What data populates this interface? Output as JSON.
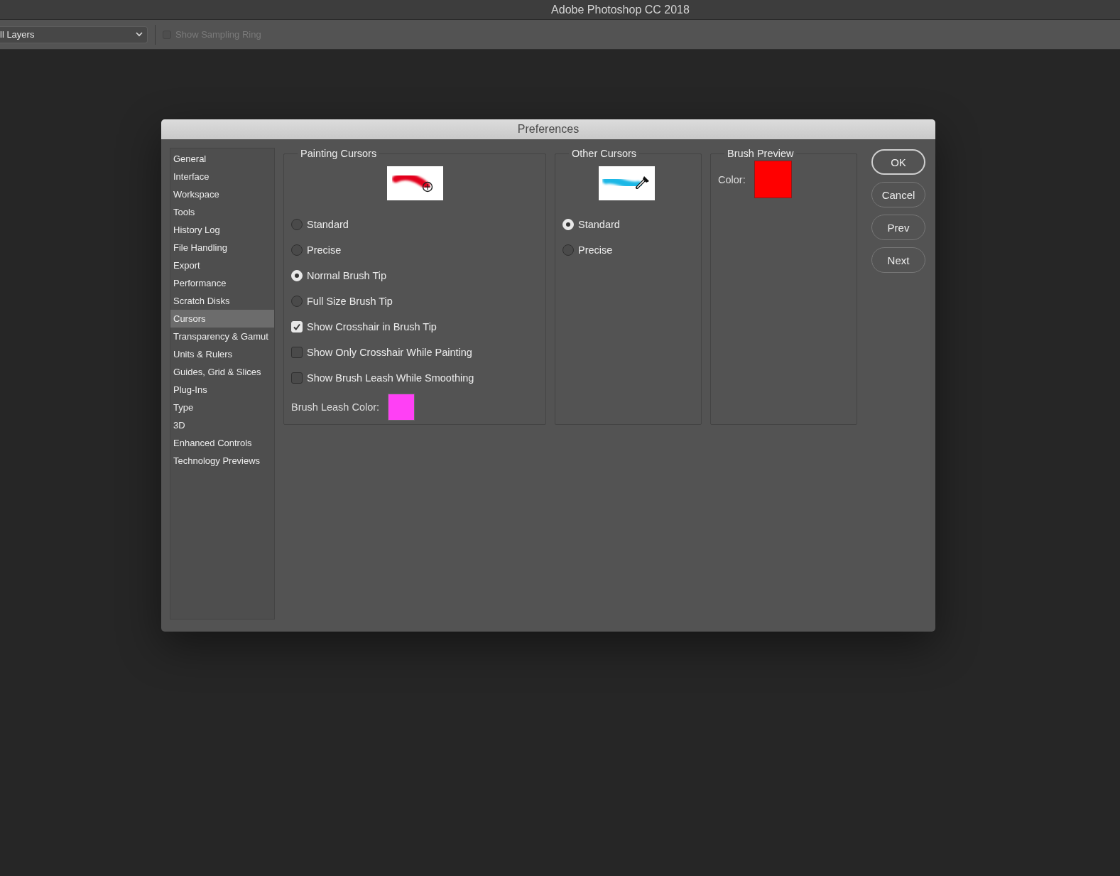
{
  "app_title": "Adobe Photoshop CC 2018",
  "toolbar": {
    "sample_dropdown": {
      "value": "ll Layers"
    },
    "sampling_ring": {
      "label": "Show Sampling Ring",
      "checked": false,
      "disabled": true
    }
  },
  "dialog": {
    "title": "Preferences",
    "sidebar": {
      "items": [
        {
          "label": "General",
          "selected": false
        },
        {
          "label": "Interface",
          "selected": false
        },
        {
          "label": "Workspace",
          "selected": false
        },
        {
          "label": "Tools",
          "selected": false
        },
        {
          "label": "History Log",
          "selected": false
        },
        {
          "label": "File Handling",
          "selected": false
        },
        {
          "label": "Export",
          "selected": false
        },
        {
          "label": "Performance",
          "selected": false
        },
        {
          "label": "Scratch Disks",
          "selected": false
        },
        {
          "label": "Cursors",
          "selected": true
        },
        {
          "label": "Transparency & Gamut",
          "selected": false
        },
        {
          "label": "Units & Rulers",
          "selected": false
        },
        {
          "label": "Guides, Grid & Slices",
          "selected": false
        },
        {
          "label": "Plug-Ins",
          "selected": false
        },
        {
          "label": "Type",
          "selected": false
        },
        {
          "label": "3D",
          "selected": false
        },
        {
          "label": "Enhanced Controls",
          "selected": false
        },
        {
          "label": "Technology Previews",
          "selected": false
        }
      ]
    },
    "painting_cursors": {
      "title": "Painting Cursors",
      "options": [
        {
          "kind": "radio",
          "label": "Standard",
          "selected": false
        },
        {
          "kind": "radio",
          "label": "Precise",
          "selected": false
        },
        {
          "kind": "radio",
          "label": "Normal Brush Tip",
          "selected": true
        },
        {
          "kind": "radio",
          "label": "Full Size Brush Tip",
          "selected": false
        },
        {
          "kind": "checkbox",
          "label": "Show Crosshair in Brush Tip",
          "checked": true
        },
        {
          "kind": "checkbox",
          "label": "Show Only Crosshair While Painting",
          "checked": false
        },
        {
          "kind": "checkbox",
          "label": "Show Brush Leash While Smoothing",
          "checked": false
        }
      ],
      "leash": {
        "label": "Brush Leash Color:",
        "color": "#ff40f5"
      }
    },
    "other_cursors": {
      "title": "Other Cursors",
      "options": [
        {
          "kind": "radio",
          "label": "Standard",
          "selected": true
        },
        {
          "kind": "radio",
          "label": "Precise",
          "selected": false
        }
      ]
    },
    "brush_preview": {
      "title": "Brush Preview",
      "label": "Color:",
      "color": "#ff0000"
    },
    "buttons": [
      {
        "label": "OK",
        "default": true
      },
      {
        "label": "Cancel",
        "default": false
      },
      {
        "label": "Prev",
        "default": false
      },
      {
        "label": "Next",
        "default": false
      }
    ]
  }
}
